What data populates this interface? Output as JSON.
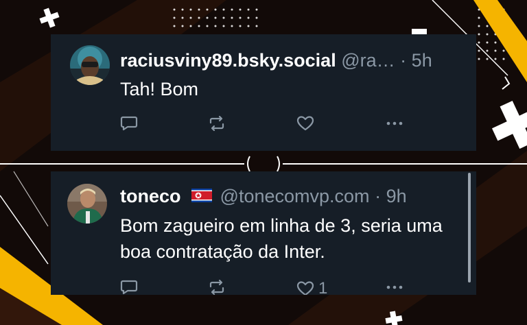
{
  "posts": [
    {
      "display_name": "raciusviny89.bsky.social",
      "handle": "@ra…",
      "separator": "·",
      "time": "5h",
      "text": "Tah! Bom",
      "reply_count": "",
      "repost_count": "",
      "like_count": ""
    },
    {
      "display_name": "toneco",
      "flag": "north-korea-flag",
      "handle": "@tonecomvp.com",
      "separator": "·",
      "time": "9h",
      "text": "Bom zagueiro em linha de 3, seria uma boa contratação da Inter.",
      "reply_count": "",
      "repost_count": "",
      "like_count": "1"
    }
  ],
  "colors": {
    "card_bg": "#161e27",
    "muted_text": "#8b98a5",
    "accent_yellow": "#f5b400",
    "background": "#120a08"
  }
}
